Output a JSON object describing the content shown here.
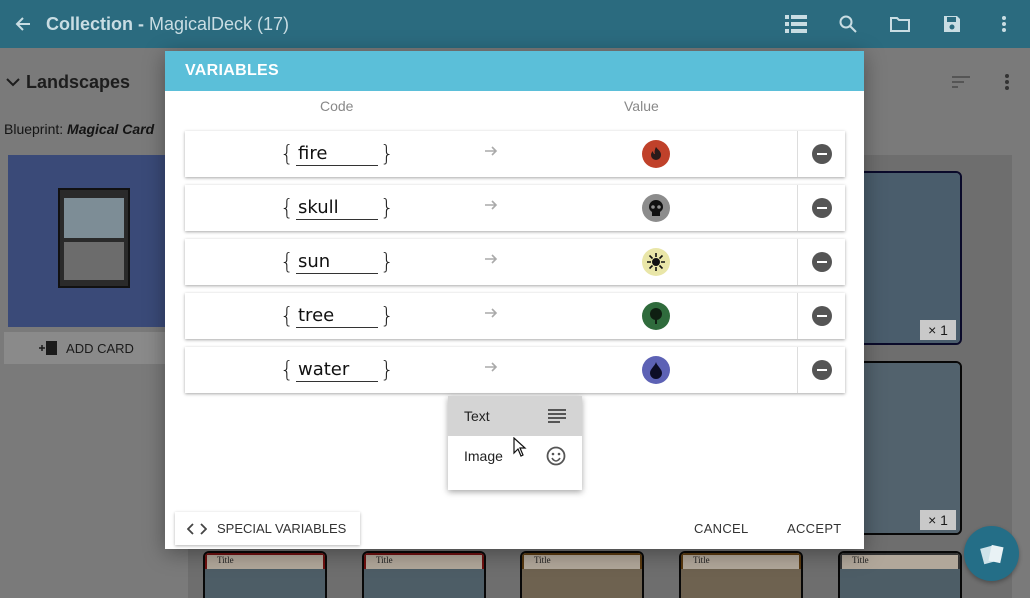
{
  "appbar": {
    "title_prefix": "Collection - ",
    "title_name": "MagicalDeck (17)",
    "icons": [
      "back-arrow-icon",
      "list-view-icon",
      "search-icon",
      "folder-icon",
      "save-icon",
      "more-vert-icon"
    ]
  },
  "background": {
    "section_title": "Landscapes",
    "blueprint_label": "Blueprint: ",
    "blueprint_name": "Magical Card",
    "add_card_label": "ADD CARD",
    "card_counts": [
      "× 1",
      "× 1"
    ],
    "card_title": "Title"
  },
  "dialog": {
    "title": "VARIABLES",
    "col_code": "Code",
    "col_value": "Value",
    "rows": [
      {
        "code": "fire",
        "symbol": "fire-symbol-icon",
        "color": "#c0412a"
      },
      {
        "code": "skull",
        "symbol": "skull-symbol-icon",
        "color": "#8c8c8c"
      },
      {
        "code": "sun",
        "symbol": "sun-symbol-icon",
        "color": "#e9e6a8"
      },
      {
        "code": "tree",
        "symbol": "tree-symbol-icon",
        "color": "#2f6b3c"
      },
      {
        "code": "water",
        "symbol": "water-symbol-icon",
        "color": "#5d62b5"
      }
    ],
    "brace_open": "{",
    "brace_close": "}",
    "popup": {
      "items": [
        {
          "label": "Text",
          "icon": "text-lines-icon"
        },
        {
          "label": "Image",
          "icon": "smiley-icon"
        }
      ]
    },
    "special_variables_label": "SPECIAL VARIABLES",
    "cancel_label": "CANCEL",
    "accept_label": "ACCEPT"
  },
  "colors": {
    "appbar": "#2b6b7f",
    "dialog_header": "#5bbfd9",
    "fab": "#246e87"
  }
}
